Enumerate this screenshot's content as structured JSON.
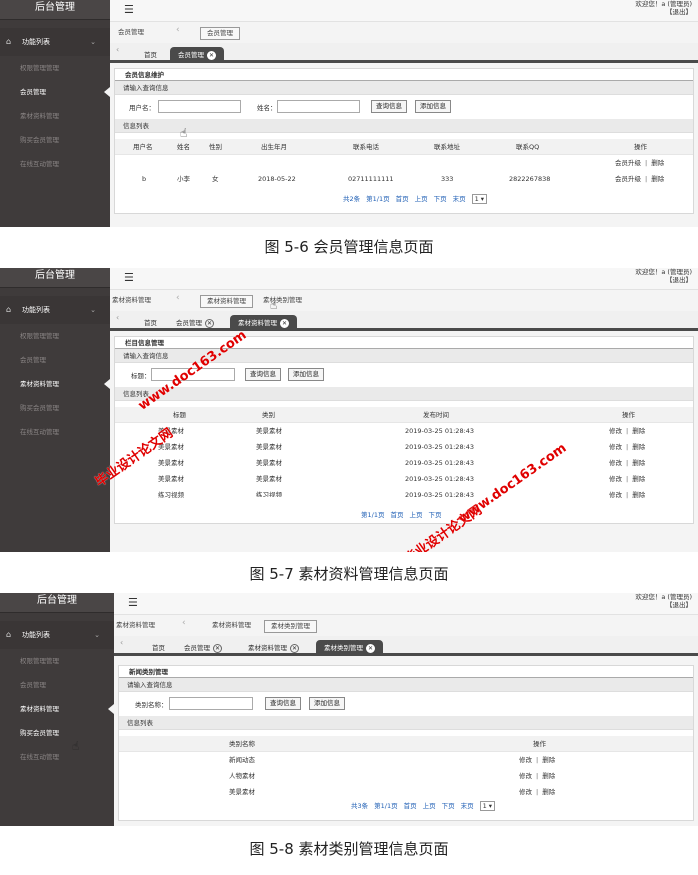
{
  "sidebar": {
    "title": "后台管理",
    "group": "功能列表",
    "items": [
      "权限管理管理",
      "会员管理",
      "素材资料管理",
      "购买会员管理",
      "在线互动管理"
    ]
  },
  "topbar": {
    "welcome": "欢迎您！a (管理员)",
    "logout": "【退出】"
  },
  "fig1": {
    "crumb1": "会员管理",
    "crumb2": "会员管理",
    "tabs": {
      "home": "首页",
      "t1": "会员管理"
    },
    "panel_title": "会员信息维护",
    "query_head": "请输入查询信息",
    "label_username": "用户名：",
    "label_name": "姓名：",
    "btn_query": "查询信息",
    "btn_add": "添加信息",
    "list_head": "信息列表",
    "columns": [
      "用户名",
      "姓名",
      "性别",
      "出生年月",
      "联系电话",
      "联系地址",
      "联系QQ",
      "操作"
    ],
    "row_ops_only": {
      "upgrade": "会员升级",
      "delete": "删除"
    },
    "row": {
      "username": "b",
      "name": "小李",
      "gender": "女",
      "birth": "2018-05-22",
      "phone": "02711111111",
      "address": "333",
      "qq": "2822267838",
      "upgrade": "会员升级",
      "delete": "删除"
    },
    "pager": {
      "total": "共2条",
      "page": "第1/1页",
      "first": "首页",
      "prev": "上页",
      "next": "下页",
      "last": "末页",
      "select": "1 ▾"
    },
    "caption": "图 5-6 会员管理信息页面"
  },
  "fig2": {
    "crumb1": "素材资料管理",
    "crumb2": "素材资料管理",
    "crumb3": "素材类别管理",
    "tabs": {
      "home": "首页",
      "t1": "会员管理",
      "t2": "素材资料管理"
    },
    "panel_title": "栏目信息管理",
    "query_head": "请输入查询信息",
    "label_title": "标题：",
    "btn_query": "查询信息",
    "btn_add": "添加信息",
    "list_head": "信息列表",
    "columns": [
      "标题",
      "类别",
      "发布时间",
      "操作"
    ],
    "rows": [
      {
        "title": "美景素材",
        "cat": "美景素材",
        "time": "2019-03-25 01:28:43"
      },
      {
        "title": "美景素材",
        "cat": "美景素材",
        "time": "2019-03-25 01:28:43"
      },
      {
        "title": "美景素材",
        "cat": "美景素材",
        "time": "2019-03-25 01:28:43"
      },
      {
        "title": "美景素材",
        "cat": "美景素材",
        "time": "2019-03-25 01:28:43"
      },
      {
        "title": "练习视频",
        "cat": "练习视频",
        "time": "2019-03-25 01:28:43"
      }
    ],
    "ops": {
      "edit": "修改",
      "delete": "删除"
    },
    "pager": {
      "page": "第1/1页",
      "first": "首页",
      "prev": "上页",
      "next": "下页"
    },
    "watermark": {
      "a": "毕业设计论文网",
      "b": "www.doc163.com"
    },
    "caption": "图 5-7 素材资料管理信息页面"
  },
  "fig3": {
    "crumb1": "素材资料管理",
    "crumb2": "素材资料管理",
    "crumb3": "素材类别管理",
    "tabs": {
      "home": "首页",
      "t1": "会员管理",
      "t2": "素材资料管理",
      "t3": "素材类别管理"
    },
    "panel_title": "新闻类别管理",
    "query_head": "请输入查询信息",
    "label_cat": "类别名称：",
    "btn_query": "查询信息",
    "btn_add": "添加信息",
    "list_head": "信息列表",
    "columns": [
      "类别名称",
      "操作"
    ],
    "rows": [
      "新闻动态",
      "人物素材",
      "美景素材"
    ],
    "ops": {
      "edit": "修改",
      "delete": "删除"
    },
    "pager": {
      "total": "共3条",
      "page": "第1/1页",
      "first": "首页",
      "prev": "上页",
      "next": "下页",
      "last": "末页",
      "select": "1 ▾"
    },
    "caption": "图 5-8 素材类别管理信息页面"
  }
}
